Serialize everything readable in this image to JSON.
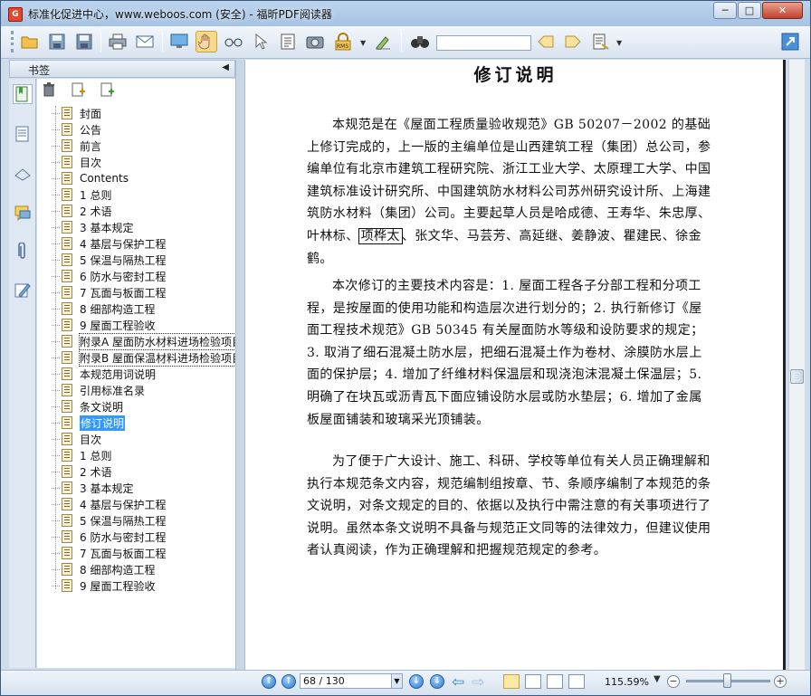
{
  "window": {
    "title": "标准化促进中心，www.weboos.com (安全) - 福昕PDF阅读器",
    "minimize": "─",
    "maximize": "□",
    "close": "✕"
  },
  "panel": {
    "title": "书签",
    "collapse": "◀"
  },
  "bookmarks": [
    {
      "label": "封面"
    },
    {
      "label": "公告"
    },
    {
      "label": "前言"
    },
    {
      "label": "目次"
    },
    {
      "label": "Contents"
    },
    {
      "label": "1 总则"
    },
    {
      "label": "2 术语"
    },
    {
      "label": "3 基本规定"
    },
    {
      "label": "4 基层与保护工程"
    },
    {
      "label": "5 保温与隔热工程"
    },
    {
      "label": "6 防水与密封工程"
    },
    {
      "label": "7 瓦面与板面工程"
    },
    {
      "label": "8 细部构造工程"
    },
    {
      "label": "9 屋面工程验收"
    },
    {
      "label": "附录A 屋面防水材料进场检验项目"
    },
    {
      "label": "附录B 屋面保温材料进场检验项目"
    },
    {
      "label": "本规范用词说明"
    },
    {
      "label": "引用标准名录"
    },
    {
      "label": "条文说明"
    },
    {
      "label": "修订说明"
    },
    {
      "label": "目次"
    },
    {
      "label": "1 总则"
    },
    {
      "label": "2 术语"
    },
    {
      "label": "3 基本规定"
    },
    {
      "label": "4 基层与保护工程"
    },
    {
      "label": "5 保温与隔热工程"
    },
    {
      "label": "6 防水与密封工程"
    },
    {
      "label": "7 瓦面与板面工程"
    },
    {
      "label": "8 细部构造工程"
    },
    {
      "label": "9 屋面工程验收"
    }
  ],
  "document": {
    "heading": "修订说明",
    "p1_a": "本规范是在《屋面工程质量验收规范》GB 50207－2002 的基础上修订完成的，上一版的主编单位是山西建筑工程（集团）总公司，参编单位有北京市建筑工程研究院、浙江工业大学、太原理工大学、中国建筑标准设计研究所、中国建筑防水材料公司苏州研究设计所、上海建筑防水材料（集团）公司。主要起草人员是哈成德、王寿华、朱忠厚、叶林标、",
    "p1_box": "项桦太",
    "p1_b": "、张文华、马芸芳、高延继、姜静波、瞿建民、徐金鹤。",
    "p2": "本次修订的主要技术内容是：1. 屋面工程各子分部工程和分项工程，是按屋面的使用功能和构造层次进行划分的；2. 执行新修订《屋面工程技术规范》GB 50345 有关屋面防水等级和设防要求的规定；3. 取消了细石混凝土防水层，把细石混凝土作为卷材、涂膜防水层上面的保护层；4. 增加了纤维材料保温层和现浇泡沫混凝土保温层；5. 明确了在块瓦或沥青瓦下面应铺设防水层或防水垫层；6. 增加了金属板屋面铺装和玻璃采光顶铺装。",
    "p3": "为了便于广大设计、施工、科研、学校等单位有关人员正确理解和执行本规范条文内容，规范编制组按章、节、条顺序编制了本规范的条文说明，对条文规定的目的、依据以及执行中需注意的有关事项进行了说明。虽然本条文说明不具备与规范正文同等的法律效力，但建议使用者认真阅读，作为正确理解和把握规范规定的参考。"
  },
  "status": {
    "page": "68 / 130",
    "zoom": "115.59%",
    "zoom_level_fraction": 0.48
  },
  "colors": {
    "selection": "#3399ff",
    "titlebar": "#a6c2e2"
  }
}
